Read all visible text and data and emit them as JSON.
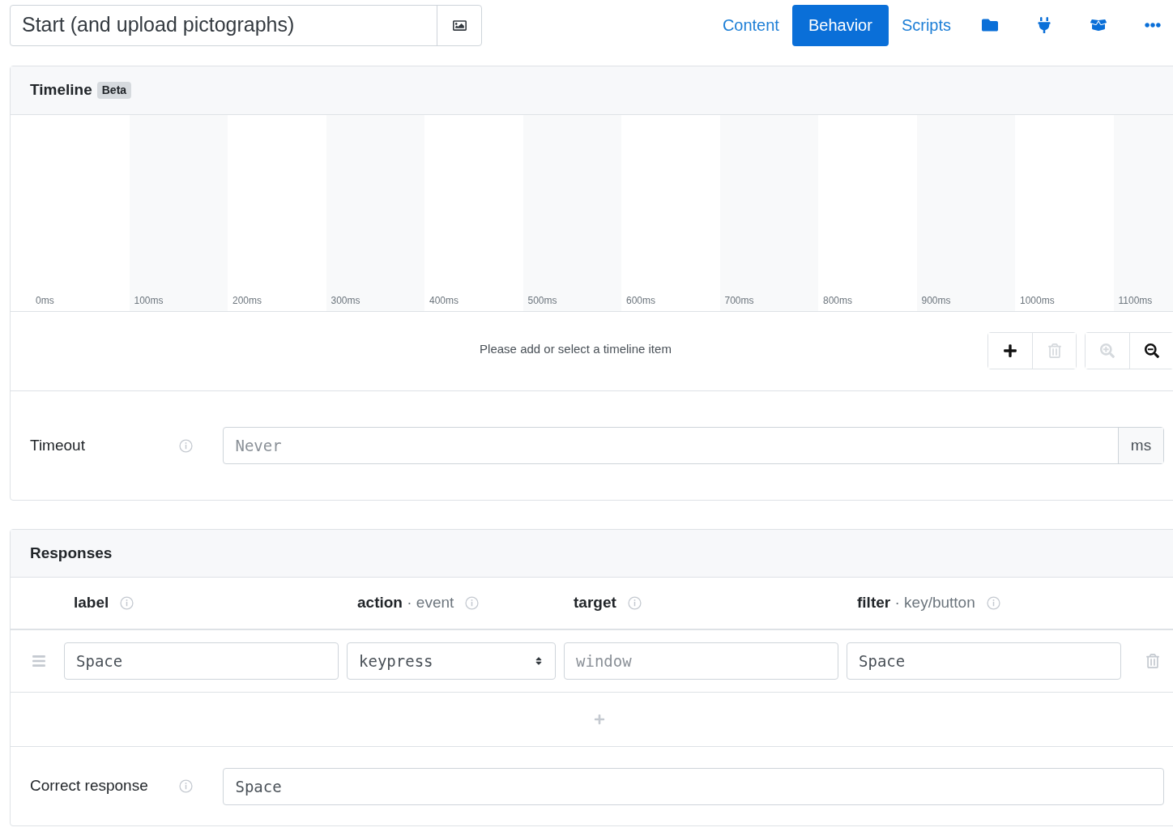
{
  "title_field": {
    "value": "Start (and upload pictographs)"
  },
  "nav": [
    {
      "kind": "text",
      "label": "Content",
      "selected": false
    },
    {
      "kind": "text",
      "label": "Behavior",
      "selected": true
    },
    {
      "kind": "text",
      "label": "Scripts",
      "selected": false
    },
    {
      "kind": "folder"
    },
    {
      "kind": "plug"
    },
    {
      "kind": "box"
    },
    {
      "kind": "more"
    }
  ],
  "timeline": {
    "title": "Timeline",
    "badge": "Beta",
    "ticks": [
      "0ms",
      "100ms",
      "200ms",
      "300ms",
      "400ms",
      "500ms",
      "600ms",
      "700ms",
      "800ms",
      "900ms",
      "1000ms",
      "1100ms"
    ],
    "message": "Please add or select a timeline item",
    "tools": [
      {
        "kind": "add",
        "disabled": false
      },
      {
        "kind": "delete",
        "disabled": true
      },
      {
        "kind": "zoom-in",
        "disabled": true
      },
      {
        "kind": "zoom-out",
        "disabled": false
      }
    ]
  },
  "timeout": {
    "label": "Timeout",
    "placeholder": "Never",
    "unit": "ms"
  },
  "responses": {
    "title": "Responses",
    "columns": [
      {
        "name": "label"
      },
      {
        "name": "action",
        "hint": "· event"
      },
      {
        "name": "target"
      },
      {
        "name": "filter",
        "hint": "· key/button"
      }
    ],
    "rows": [
      {
        "label": "Space",
        "action": "keypress",
        "target_placeholder": "window",
        "filter": "Space"
      }
    ]
  },
  "correct_response": {
    "label": "Correct response",
    "value": "Space"
  }
}
